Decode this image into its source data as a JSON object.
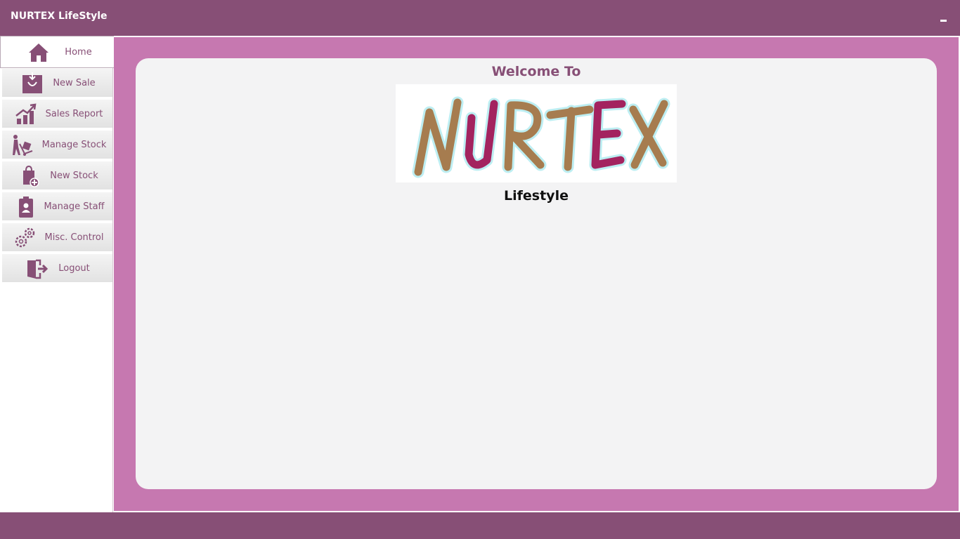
{
  "app": {
    "title": "NURTEX LifeStyle"
  },
  "colors": {
    "primary": "#874f76",
    "frame": "#c678b0",
    "card": "#f3f3f4",
    "logo_tan": "#a67c4f",
    "logo_magenta": "#a3235f"
  },
  "sidebar": {
    "items": [
      {
        "label": "Home",
        "icon": "home-icon"
      },
      {
        "label": "New Sale",
        "icon": "shopping-bag-icon"
      },
      {
        "label": "Sales Report",
        "icon": "chart-growth-icon"
      },
      {
        "label": "Manage Stock",
        "icon": "hand-truck-icon"
      },
      {
        "label": "New Stock",
        "icon": "bag-add-icon"
      },
      {
        "label": "Manage Staff",
        "icon": "id-badge-icon"
      },
      {
        "label": "Misc. Control",
        "icon": "gears-icon"
      },
      {
        "label": "Logout",
        "icon": "logout-door-icon"
      }
    ]
  },
  "main": {
    "welcome": "Welcome To",
    "logo_text": "NURTEX",
    "subtitle": "Lifestyle"
  }
}
